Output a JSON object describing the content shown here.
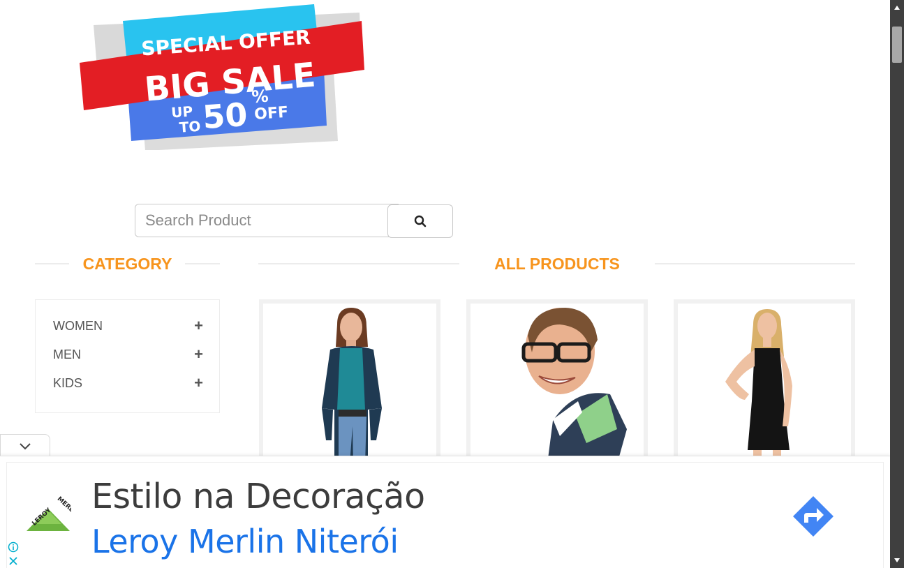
{
  "banner": {
    "line1": "SPECIAL OFFER",
    "line2": "BIG SALE",
    "up": "UP",
    "to": "TO",
    "percent_value": "50",
    "percent_sign": "%",
    "off": "OFF"
  },
  "search": {
    "placeholder": "Search Product",
    "button_icon": "search-icon"
  },
  "category": {
    "title": "CATEGORY",
    "items": [
      {
        "label": "WOMEN",
        "icon": "plus-icon"
      },
      {
        "label": "MEN",
        "icon": "plus-icon"
      },
      {
        "label": "KIDS",
        "icon": "plus-icon"
      }
    ]
  },
  "products": {
    "title": "ALL PRODUCTS",
    "items": [
      {
        "image": "woman-casual-photo"
      },
      {
        "image": "man-glasses-photo"
      },
      {
        "image": "woman-black-dress-photo"
      }
    ]
  },
  "ad": {
    "title": "Estilo na Decoração",
    "subtitle": "Leroy Merlin Niterói",
    "logo_text": "LEROY MERLIN",
    "colors": {
      "title": "#3c3c3c",
      "subtitle": "#1a73e8",
      "action": "#4285f4",
      "logo_green": "#6cb33f"
    }
  },
  "colors": {
    "accent": "#f7941d",
    "banner_red": "#e31e24",
    "banner_cyan": "#29c3ef",
    "banner_blue": "#4a79e8"
  }
}
